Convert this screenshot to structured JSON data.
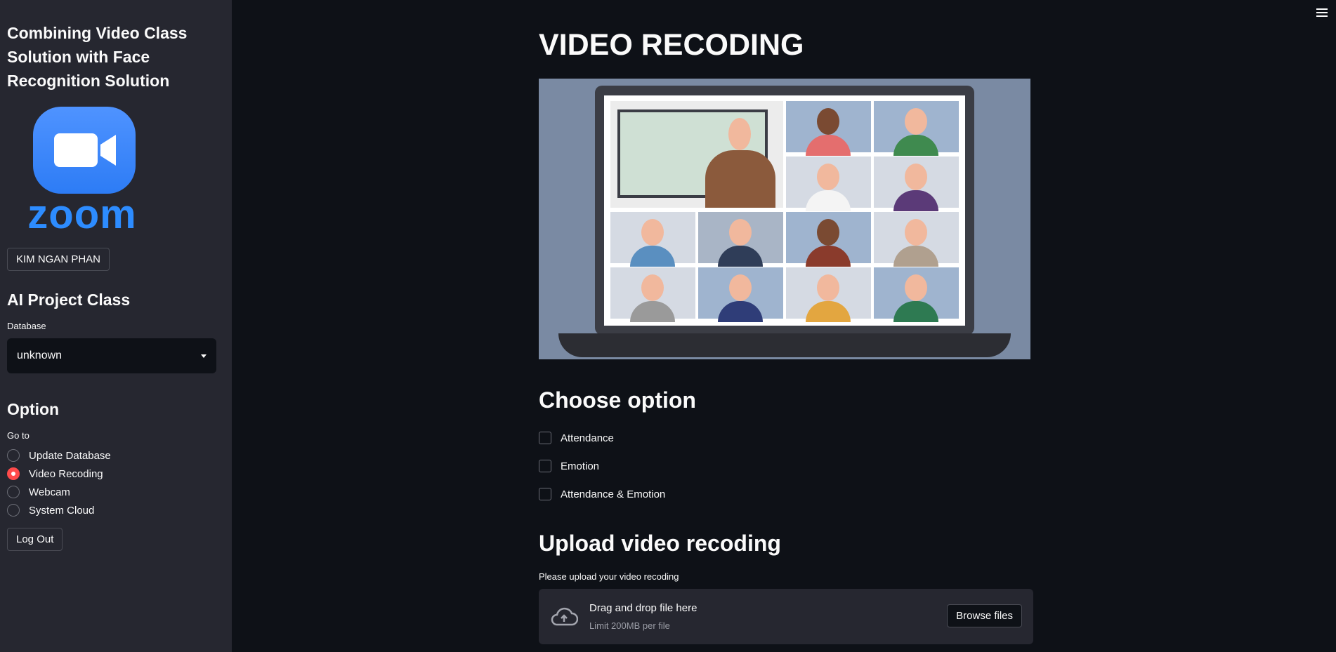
{
  "sidebar": {
    "app_title": "Combining Video Class Solution with Face Recognition Solution",
    "logo_word": "zoom",
    "user_button": "KIM NGAN PHAN",
    "project_heading": "AI Project Class",
    "database_label": "Database",
    "database_value": "unknown",
    "option_heading": "Option",
    "goto_label": "Go to",
    "radio_options": [
      {
        "label": "Update Database",
        "selected": false
      },
      {
        "label": "Video Recoding",
        "selected": true
      },
      {
        "label": "Webcam",
        "selected": false
      },
      {
        "label": "System Cloud",
        "selected": false
      }
    ],
    "logout_button": "Log Out"
  },
  "main": {
    "page_title": "VIDEO RECODING",
    "choose_heading": "Choose option",
    "checkboxes": [
      {
        "label": "Attendance",
        "checked": false
      },
      {
        "label": "Emotion",
        "checked": false
      },
      {
        "label": "Attendance & Emotion",
        "checked": false
      }
    ],
    "upload_heading": "Upload video recoding",
    "upload_label": "Please upload your video recoding",
    "dropzone_title": "Drag and drop file here",
    "dropzone_limit": "Limit 200MB per file",
    "browse_button": "Browse files"
  },
  "icons": {
    "menu": "hamburger-menu-icon",
    "upload": "cloud-upload-icon",
    "select": "chevron-down-icon"
  },
  "colors": {
    "accent": "#ff4b4b",
    "background": "#0e1117",
    "sidebar": "#262730",
    "zoom_blue": "#2d8cff"
  }
}
